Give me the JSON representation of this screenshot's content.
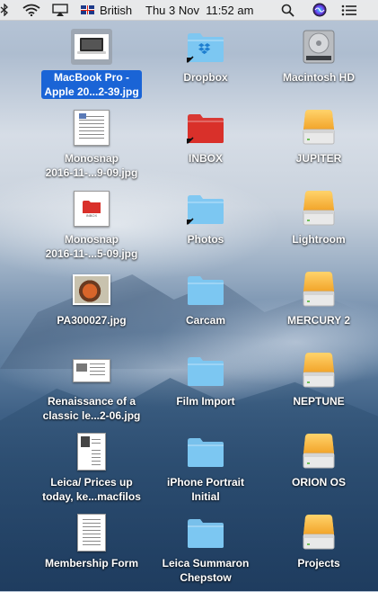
{
  "menubar": {
    "input_source": "British",
    "clock": "Thu 3 Nov  11:52 am"
  },
  "desktop": {
    "col1": [
      {
        "label_lines": [
          "MacBook Pro -",
          "Apple 20...2-39.jpg"
        ],
        "kind": "macbook-thumb",
        "selected": true
      },
      {
        "label_lines": [
          "Monosnap",
          "2016-11-...9-09.jpg"
        ],
        "kind": "document-thumb"
      },
      {
        "label_lines": [
          "Monosnap",
          "2016-11-...5-09.jpg"
        ],
        "kind": "inbox-thumb"
      },
      {
        "label_lines": [
          "PA300027.jpg"
        ],
        "kind": "photo-thumb"
      },
      {
        "label_lines": [
          "Renaissance of a",
          "classic le...2-06.jpg"
        ],
        "kind": "webpage-thumb"
      },
      {
        "label_lines": [
          "Leica/ Prices up",
          "today, ke...macfilos"
        ],
        "kind": "webloc-thumb"
      },
      {
        "label_lines": [
          "Membership Form"
        ],
        "kind": "form-thumb"
      }
    ],
    "col2": [
      {
        "label_lines": [
          "Dropbox"
        ],
        "kind": "dropbox-folder"
      },
      {
        "label_lines": [
          "INBOX"
        ],
        "kind": "red-folder-alias"
      },
      {
        "label_lines": [
          "Photos"
        ],
        "kind": "folder-alias"
      },
      {
        "label_lines": [
          "Carcam"
        ],
        "kind": "folder"
      },
      {
        "label_lines": [
          "Film Import"
        ],
        "kind": "folder"
      },
      {
        "label_lines": [
          "iPhone Portrait",
          "Initial"
        ],
        "kind": "folder"
      },
      {
        "label_lines": [
          "Leica Summaron",
          "Chepstow"
        ],
        "kind": "folder"
      }
    ],
    "col3": [
      {
        "label_lines": [
          "Macintosh HD"
        ],
        "kind": "internal-drive"
      },
      {
        "label_lines": [
          "JUPITER"
        ],
        "kind": "external-drive"
      },
      {
        "label_lines": [
          "Lightroom"
        ],
        "kind": "external-drive"
      },
      {
        "label_lines": [
          "MERCURY 2"
        ],
        "kind": "external-drive"
      },
      {
        "label_lines": [
          "NEPTUNE"
        ],
        "kind": "external-drive"
      },
      {
        "label_lines": [
          "ORION OS"
        ],
        "kind": "external-drive"
      },
      {
        "label_lines": [
          "Projects"
        ],
        "kind": "external-drive"
      }
    ]
  },
  "colors": {
    "selection": "#1a64d6",
    "folder_blue": "#7cc7f2",
    "folder_red": "#d9302a",
    "drive_orange": "#f2a42a"
  }
}
